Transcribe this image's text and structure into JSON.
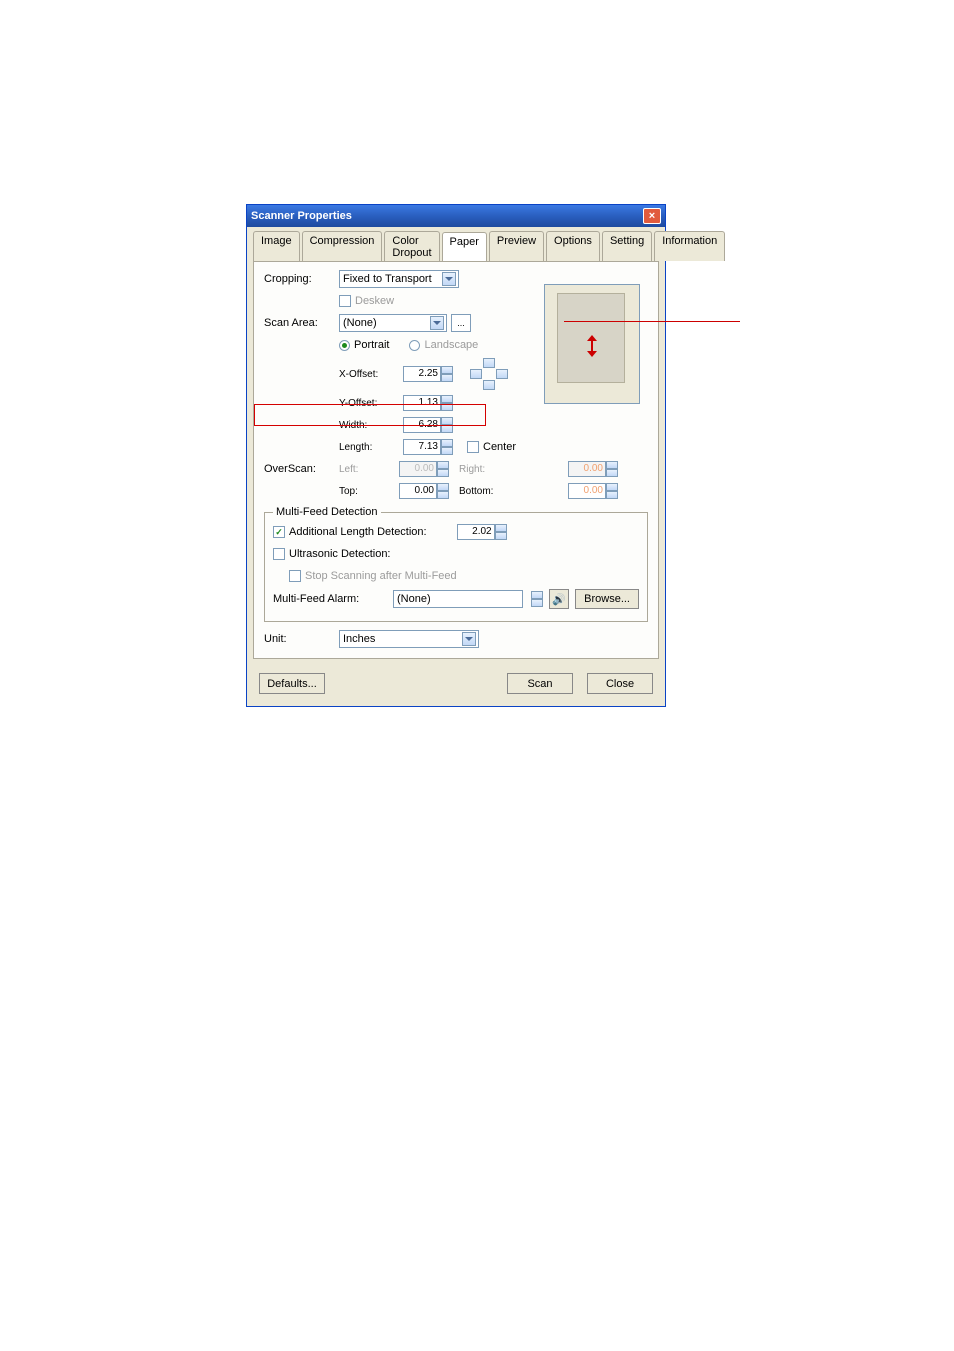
{
  "window": {
    "title": "Scanner Properties"
  },
  "tabs": [
    "Image",
    "Compression",
    "Color Dropout",
    "Paper",
    "Preview",
    "Options",
    "Setting",
    "Information"
  ],
  "active_tab": "Paper",
  "labels": {
    "cropping": "Cropping:",
    "deskew": "Deskew",
    "scan_area": "Scan Area:",
    "portrait": "Portrait",
    "landscape": "Landscape",
    "xoffset": "X-Offset:",
    "yoffset": "Y-Offset:",
    "width": "Width:",
    "length": "Length:",
    "center": "Center",
    "overscan": "OverScan:",
    "left": "Left:",
    "right": "Right:",
    "top": "Top:",
    "bottom": "Bottom:",
    "mfd": "Multi-Feed Detection",
    "ald": "Additional Length Detection:",
    "ultra": "Ultrasonic Detection:",
    "stop": "Stop Scanning after Multi-Feed",
    "alarm": "Multi-Feed Alarm:",
    "unit": "Unit:",
    "browse": "Browse...",
    "defaults": "Defaults...",
    "scan": "Scan",
    "close": "Close",
    "ellipsis": "..."
  },
  "values": {
    "cropping": "Fixed to Transport",
    "scan_area": "(None)",
    "xoffset": "2.25",
    "yoffset": "1.13",
    "width": "6.28",
    "length": "7.13",
    "left": "0.00",
    "right": "0.00",
    "top": "0.00",
    "bottom": "0.00",
    "ald": "2.02",
    "alarm": "(None)",
    "unit": "Inches"
  }
}
